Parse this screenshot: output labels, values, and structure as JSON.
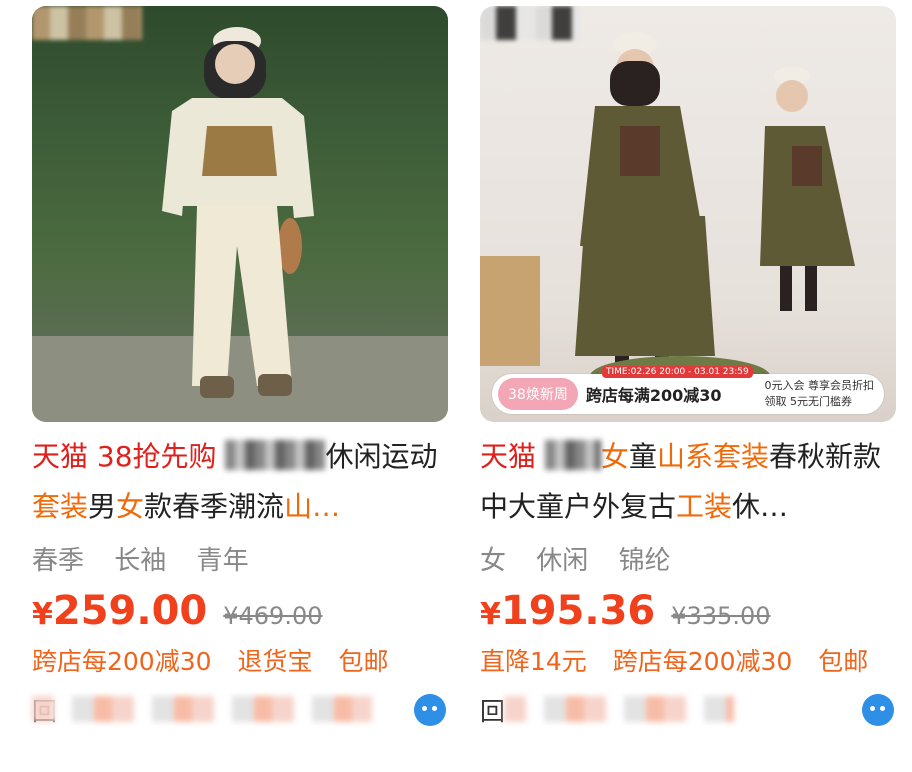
{
  "cards": [
    {
      "image_alt": "woman in beige hiking jacket and pants in forest",
      "title": {
        "brand": "天猫",
        "campaign": "38抢先购",
        "text_1": "休闲运动",
        "hl_1": "套装",
        "text_2": "男",
        "hl_2": "女",
        "text_3": "款春季潮流",
        "hl_3": "山…"
      },
      "tags": [
        "春季",
        "长袖",
        "青年"
      ],
      "price": "259.00",
      "currency": "¥",
      "original_price": "¥469.00",
      "benefits": [
        "跨店每200减30",
        "退货宝",
        "包邮"
      ],
      "shop_prefix": "回"
    },
    {
      "image_alt": "two children in olive outdoor work-style outfits",
      "promo": {
        "tag": "38焕新周",
        "date": "TIME:02.26 20:00 - 03.01 23:59",
        "main": "跨店每满200减30",
        "right_1": "0元入会 尊享会员折扣",
        "right_2": "领取 5元无门槛券"
      },
      "title": {
        "brand": "天猫",
        "hl_1": "女",
        "text_1": "童",
        "hl_2": "山系套装",
        "text_2": "春秋新款中大童户外复古",
        "hl_3": "工装",
        "text_3": "休…"
      },
      "tags": [
        "女",
        "休闲",
        "锦纶"
      ],
      "price": "195.36",
      "currency": "¥",
      "original_price": "¥335.00",
      "benefits": [
        "直降14元",
        "跨店每200减30",
        "包邮"
      ],
      "shop_prefix": "回"
    }
  ],
  "colors": {
    "tmall_red": "#e0201c",
    "highlight_orange": "#f06a0a",
    "price_red": "#f0401c",
    "benefit_orange": "#f0641c",
    "shop_icon_blue": "#2e8fe6"
  }
}
